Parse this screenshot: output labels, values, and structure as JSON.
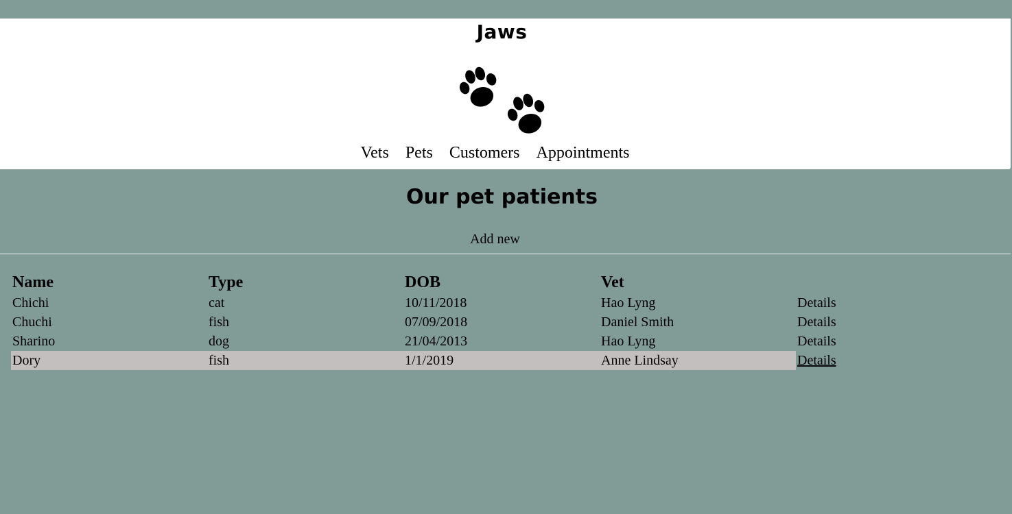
{
  "header": {
    "brand": "Jaws",
    "logo_icon": "paw-prints-icon"
  },
  "nav": {
    "items": [
      {
        "label": "Vets"
      },
      {
        "label": "Pets"
      },
      {
        "label": "Customers"
      },
      {
        "label": "Appointments"
      }
    ]
  },
  "main": {
    "title": "Our pet patients",
    "add_new_label": "Add new"
  },
  "table": {
    "headers": [
      "Name",
      "Type",
      "DOB",
      "Vet",
      ""
    ],
    "rows": [
      {
        "name": "Chichi",
        "type": "cat",
        "dob": "10/11/2018",
        "vet": "Hao Lyng",
        "action": "Details"
      },
      {
        "name": "Chuchi",
        "type": "fish",
        "dob": "07/09/2018",
        "vet": "Daniel Smith",
        "action": "Details"
      },
      {
        "name": "Sharino",
        "type": "dog",
        "dob": "21/04/2013",
        "vet": "Hao Lyng",
        "action": "Details"
      },
      {
        "name": "Dory",
        "type": "fish",
        "dob": "1/1/2019",
        "vet": "Anne Lindsay",
        "action": "Details"
      }
    ],
    "highlighted_row": 3
  },
  "colors": {
    "page_background": "#819b97",
    "header_background": "#ffffff",
    "row_highlight": "#c3bfbf"
  }
}
